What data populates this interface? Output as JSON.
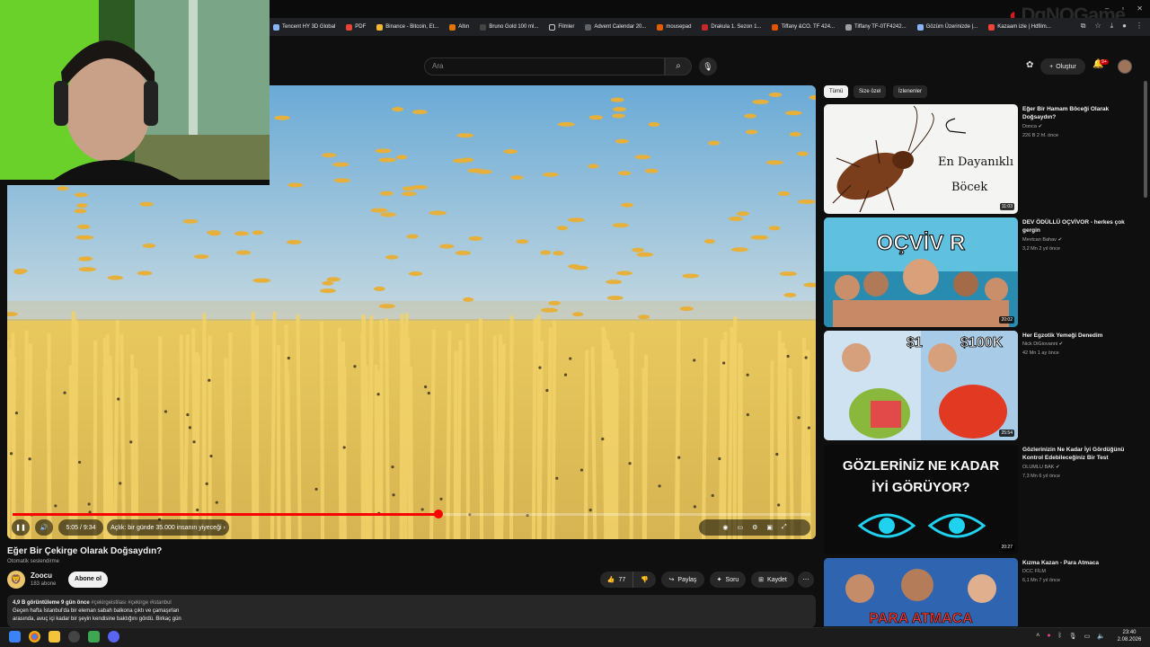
{
  "browser": {
    "bookmarks": [
      {
        "label": "Tencent HY 3D Global"
      },
      {
        "label": "PDF"
      },
      {
        "label": "Binance - Bitcoin, Et..."
      },
      {
        "label": "Altın"
      },
      {
        "label": "Bruno Gold 100 ml..."
      },
      {
        "label": "Filmler"
      },
      {
        "label": "Advent Calendar 20..."
      },
      {
        "label": "mousepad"
      },
      {
        "label": "Drakula 1. Sezon 1..."
      },
      {
        "label": "Tiffany &CO. TF 424..."
      },
      {
        "label": "Tiffany TF-0TF4242..."
      },
      {
        "label": "Gözüm Üzerinizde |..."
      },
      {
        "label": "Kazaam izle | Hdfilm..."
      }
    ],
    "watermark": "DgNOGame"
  },
  "header": {
    "search_placeholder": "Ara",
    "create_label": "Oluştur",
    "notification_count": "9+"
  },
  "player": {
    "progress_fraction": 0.534,
    "time": "5:05 / 9:34",
    "chapter": "Açlık: bir günde 35.000 insanın yiyeceği"
  },
  "video": {
    "title": "Eğer Bir Çekirge Olarak Doğsaydın?",
    "auto_dub": "Otomatik seslendirme",
    "channel": "Zoocu",
    "subscribers": "183 abone",
    "subscribe_label": "Abone ol",
    "likes": "77",
    "share_label": "Paylaş",
    "ask_label": "Soru",
    "save_label": "Kaydet",
    "desc_stats": "4,9 B görüntüleme  9 gün önce",
    "desc_tags": "#çekirgeistilası #çekirge #istanbul",
    "desc_line1": "Geçen hafta İstanbul'da bir eleman sabah balkona çıktı ve çamaşırları",
    "desc_line2": "arasında, avuç içi kadar bir şeyin kendisine baktığını gördü. Birkaç gün"
  },
  "chips": [
    "Tümü",
    "Size özel",
    "İzlenenler"
  ],
  "recommendations": [
    {
      "title": "Eğer Bir Hamam Böceği Olarak Doğsaydın?",
      "channel": "Donca",
      "meta": "226 B  2 hf. önce",
      "duration": "11:03",
      "thumb_text_1": "En Dayanıklı",
      "thumb_text_2": "Böcek"
    },
    {
      "title": "DEV ÖDÜLLÜ OÇVİVOR - herkes çok gergin",
      "channel": "Mevtcan Bahav",
      "meta": "3,2 Mn  2 yıl önce",
      "duration": "20:02",
      "thumb_text_1": "OÇVİV R"
    },
    {
      "title": "Her Egzotik Yemeği Denedim",
      "channel": "Nick DiGiovanni",
      "meta": "42 Mn  1 ay önce",
      "duration": "25:54",
      "thumb_text_1": "$1",
      "thumb_text_2": "$100K"
    },
    {
      "title": "Gözlerinizin Ne Kadar İyi Gördüğünü Kontrol Edebileceğiniz Bir Test",
      "channel": "OLUMLU BAK",
      "meta": "7,3 Mn  6 yıl önce",
      "duration": "20:27",
      "thumb_text_1": "GÖZLERİNİZ NE KADAR",
      "thumb_text_2": "İYİ GÖRÜYOR?"
    },
    {
      "title": "Kızma Kazan - Para Atmaca",
      "channel": "DCC FİLM",
      "meta": "6,1 Mn  7 yıl önce",
      "duration": "",
      "thumb_text_1": "PARA ATMACA"
    }
  ],
  "taskbar": {
    "time": "23:40",
    "date": "2.08.2026"
  },
  "colors": {
    "accent_red": "#ff0000",
    "background": "#0f0f0f",
    "sky": "#7eb6dc",
    "wheat": "#e3bf58"
  }
}
